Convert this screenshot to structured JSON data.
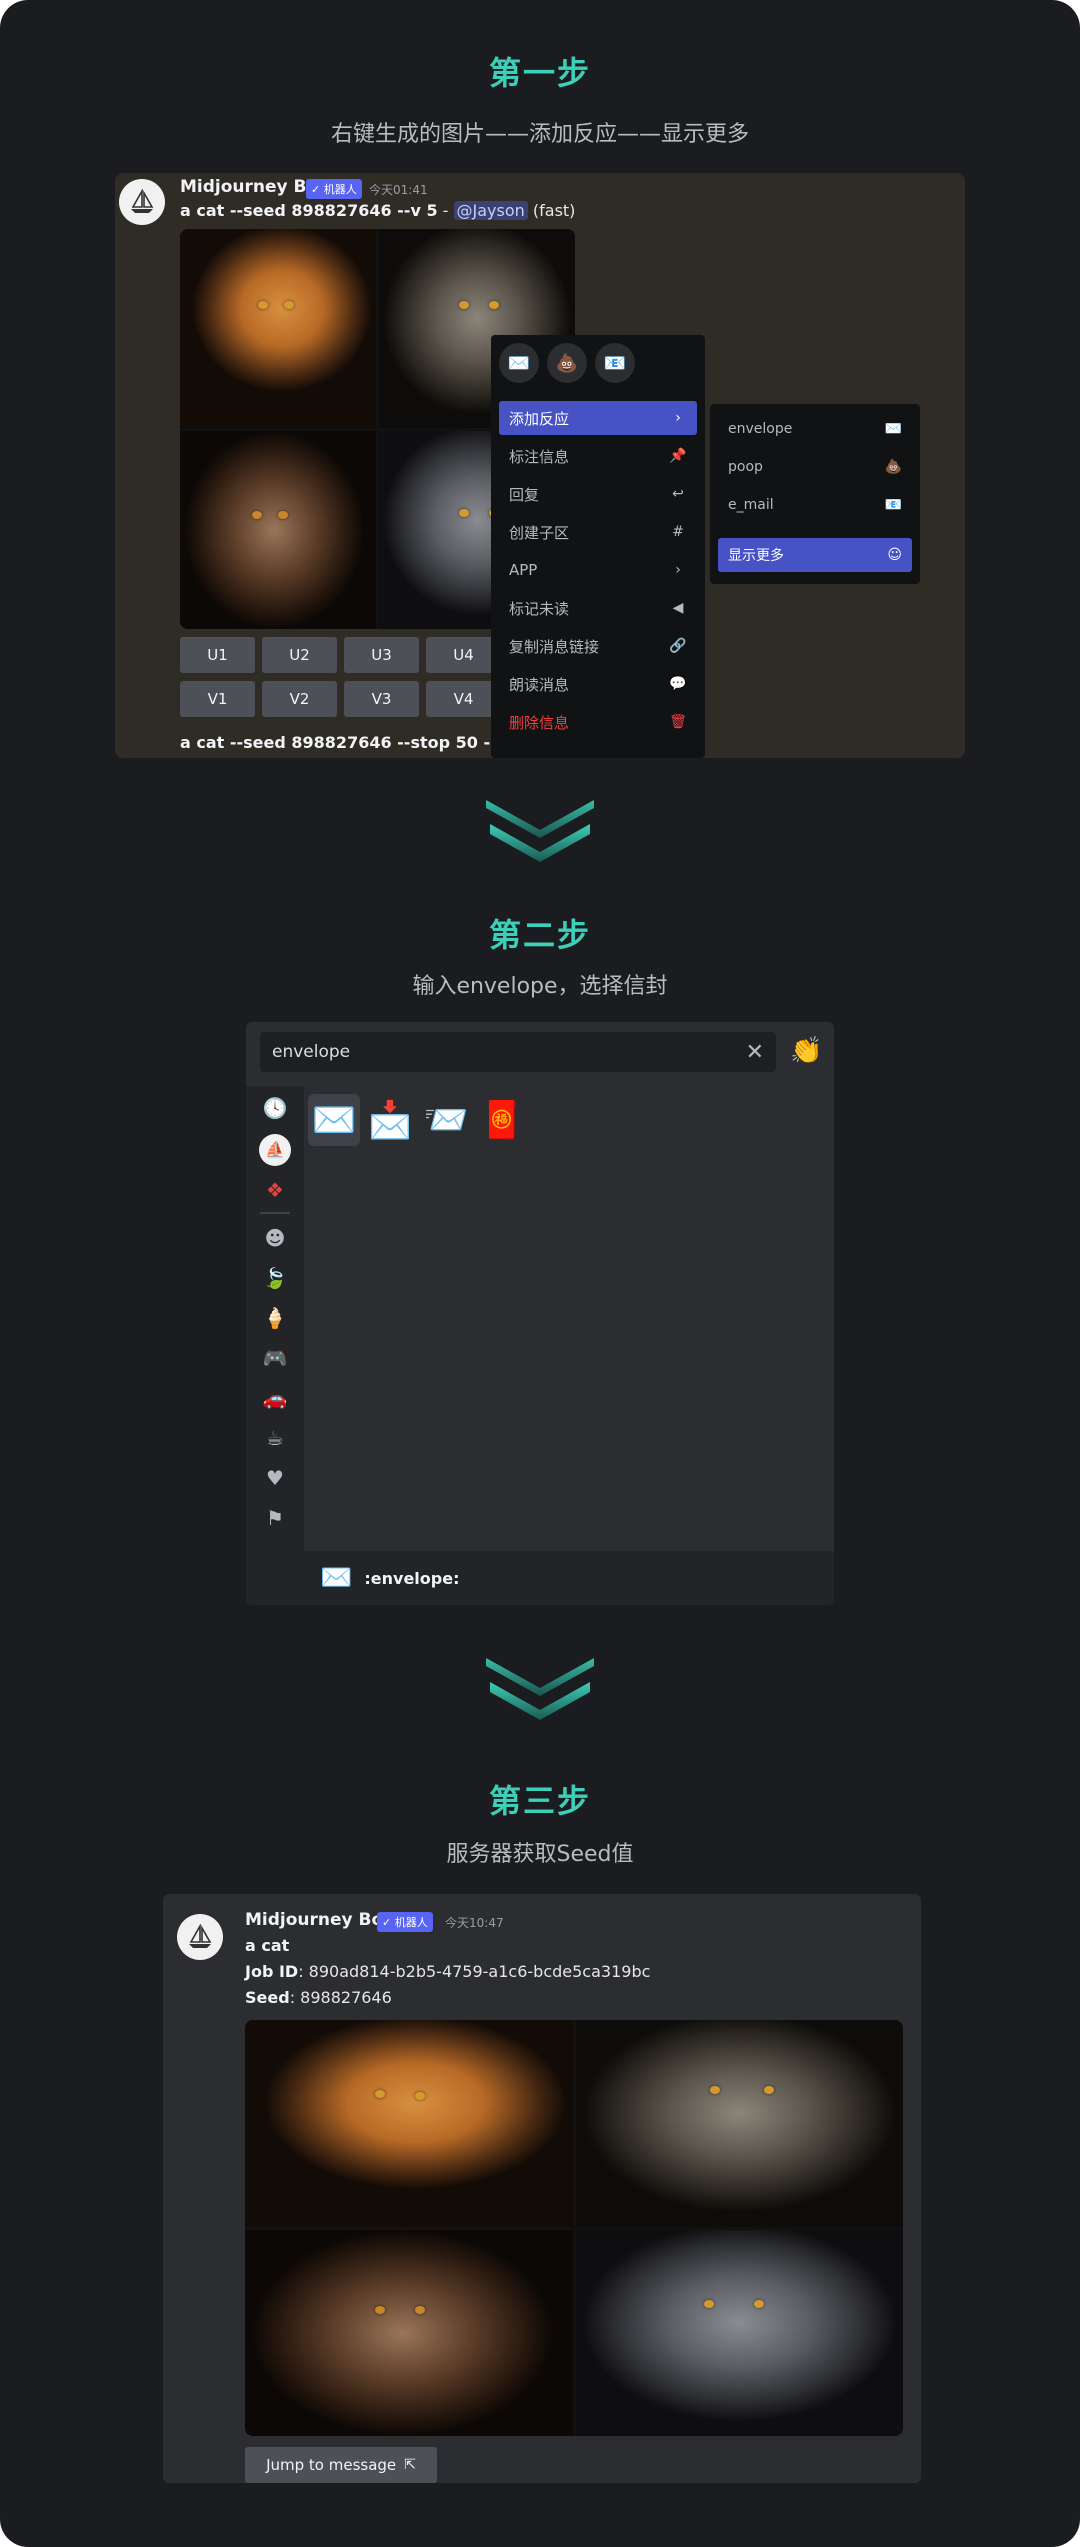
{
  "steps": [
    {
      "title": "第一步",
      "desc": "右键生成的图片——添加反应——显示更多"
    },
    {
      "title": "第二步",
      "desc": "输入envelope，选择信封"
    },
    {
      "title": "第三步",
      "desc": "服务器获取Seed值"
    }
  ],
  "step1": {
    "bot_name": "Midjourney Bot",
    "bot_tag": "✓ 机器人",
    "timestamp": "今天01:41",
    "prompt_bold": "a cat --seed 898827646 --v 5",
    "prompt_sep": " - ",
    "mention": "@Jayson",
    "mode": " (fast)",
    "upscale_buttons": [
      "U1",
      "U2",
      "U3",
      "U4"
    ],
    "variation_buttons": [
      "V1",
      "V2",
      "V3",
      "V4"
    ],
    "bottom_line": "a cat --seed 898827646 --stop 50 --v 5",
    "context_menu": [
      {
        "label": "添加反应",
        "icon": "chevron-right",
        "active": true
      },
      {
        "label": "标注信息",
        "icon": "pin"
      },
      {
        "label": "回复",
        "icon": "reply"
      },
      {
        "label": "创建子区",
        "icon": "thread"
      },
      {
        "label": "APP",
        "icon": "chevron-right"
      },
      {
        "label": "标记未读",
        "icon": "flag"
      },
      {
        "label": "复制消息链接",
        "icon": "link"
      },
      {
        "label": "朗读消息",
        "icon": "speech"
      },
      {
        "label": "删除信息",
        "icon": "trash",
        "danger": true
      }
    ],
    "submenu": [
      {
        "label": "envelope",
        "icon": "envelope"
      },
      {
        "label": "poop",
        "icon": "poop"
      },
      {
        "label": "e_mail",
        "icon": "e-mail"
      },
      {
        "label": "显示更多",
        "icon": "more",
        "active": true
      }
    ]
  },
  "step2": {
    "search_value": "envelope",
    "footer_name": ":envelope:"
  },
  "step3": {
    "bot_name": "Midjourney Bot",
    "bot_tag": "✓ 机器人",
    "timestamp": "今天10:47",
    "title": "a cat",
    "job_label": "Job ID",
    "job_value": ": 890ad814-b2b5-4759-a1c6-bcde5ca319bc",
    "seed_label": "Seed",
    "seed_value": ": 898827646",
    "jump_label": "Jump to message"
  },
  "colors": {
    "accent": "#3ecfb8",
    "blurple": "#4752c4",
    "danger": "#f23f43"
  }
}
